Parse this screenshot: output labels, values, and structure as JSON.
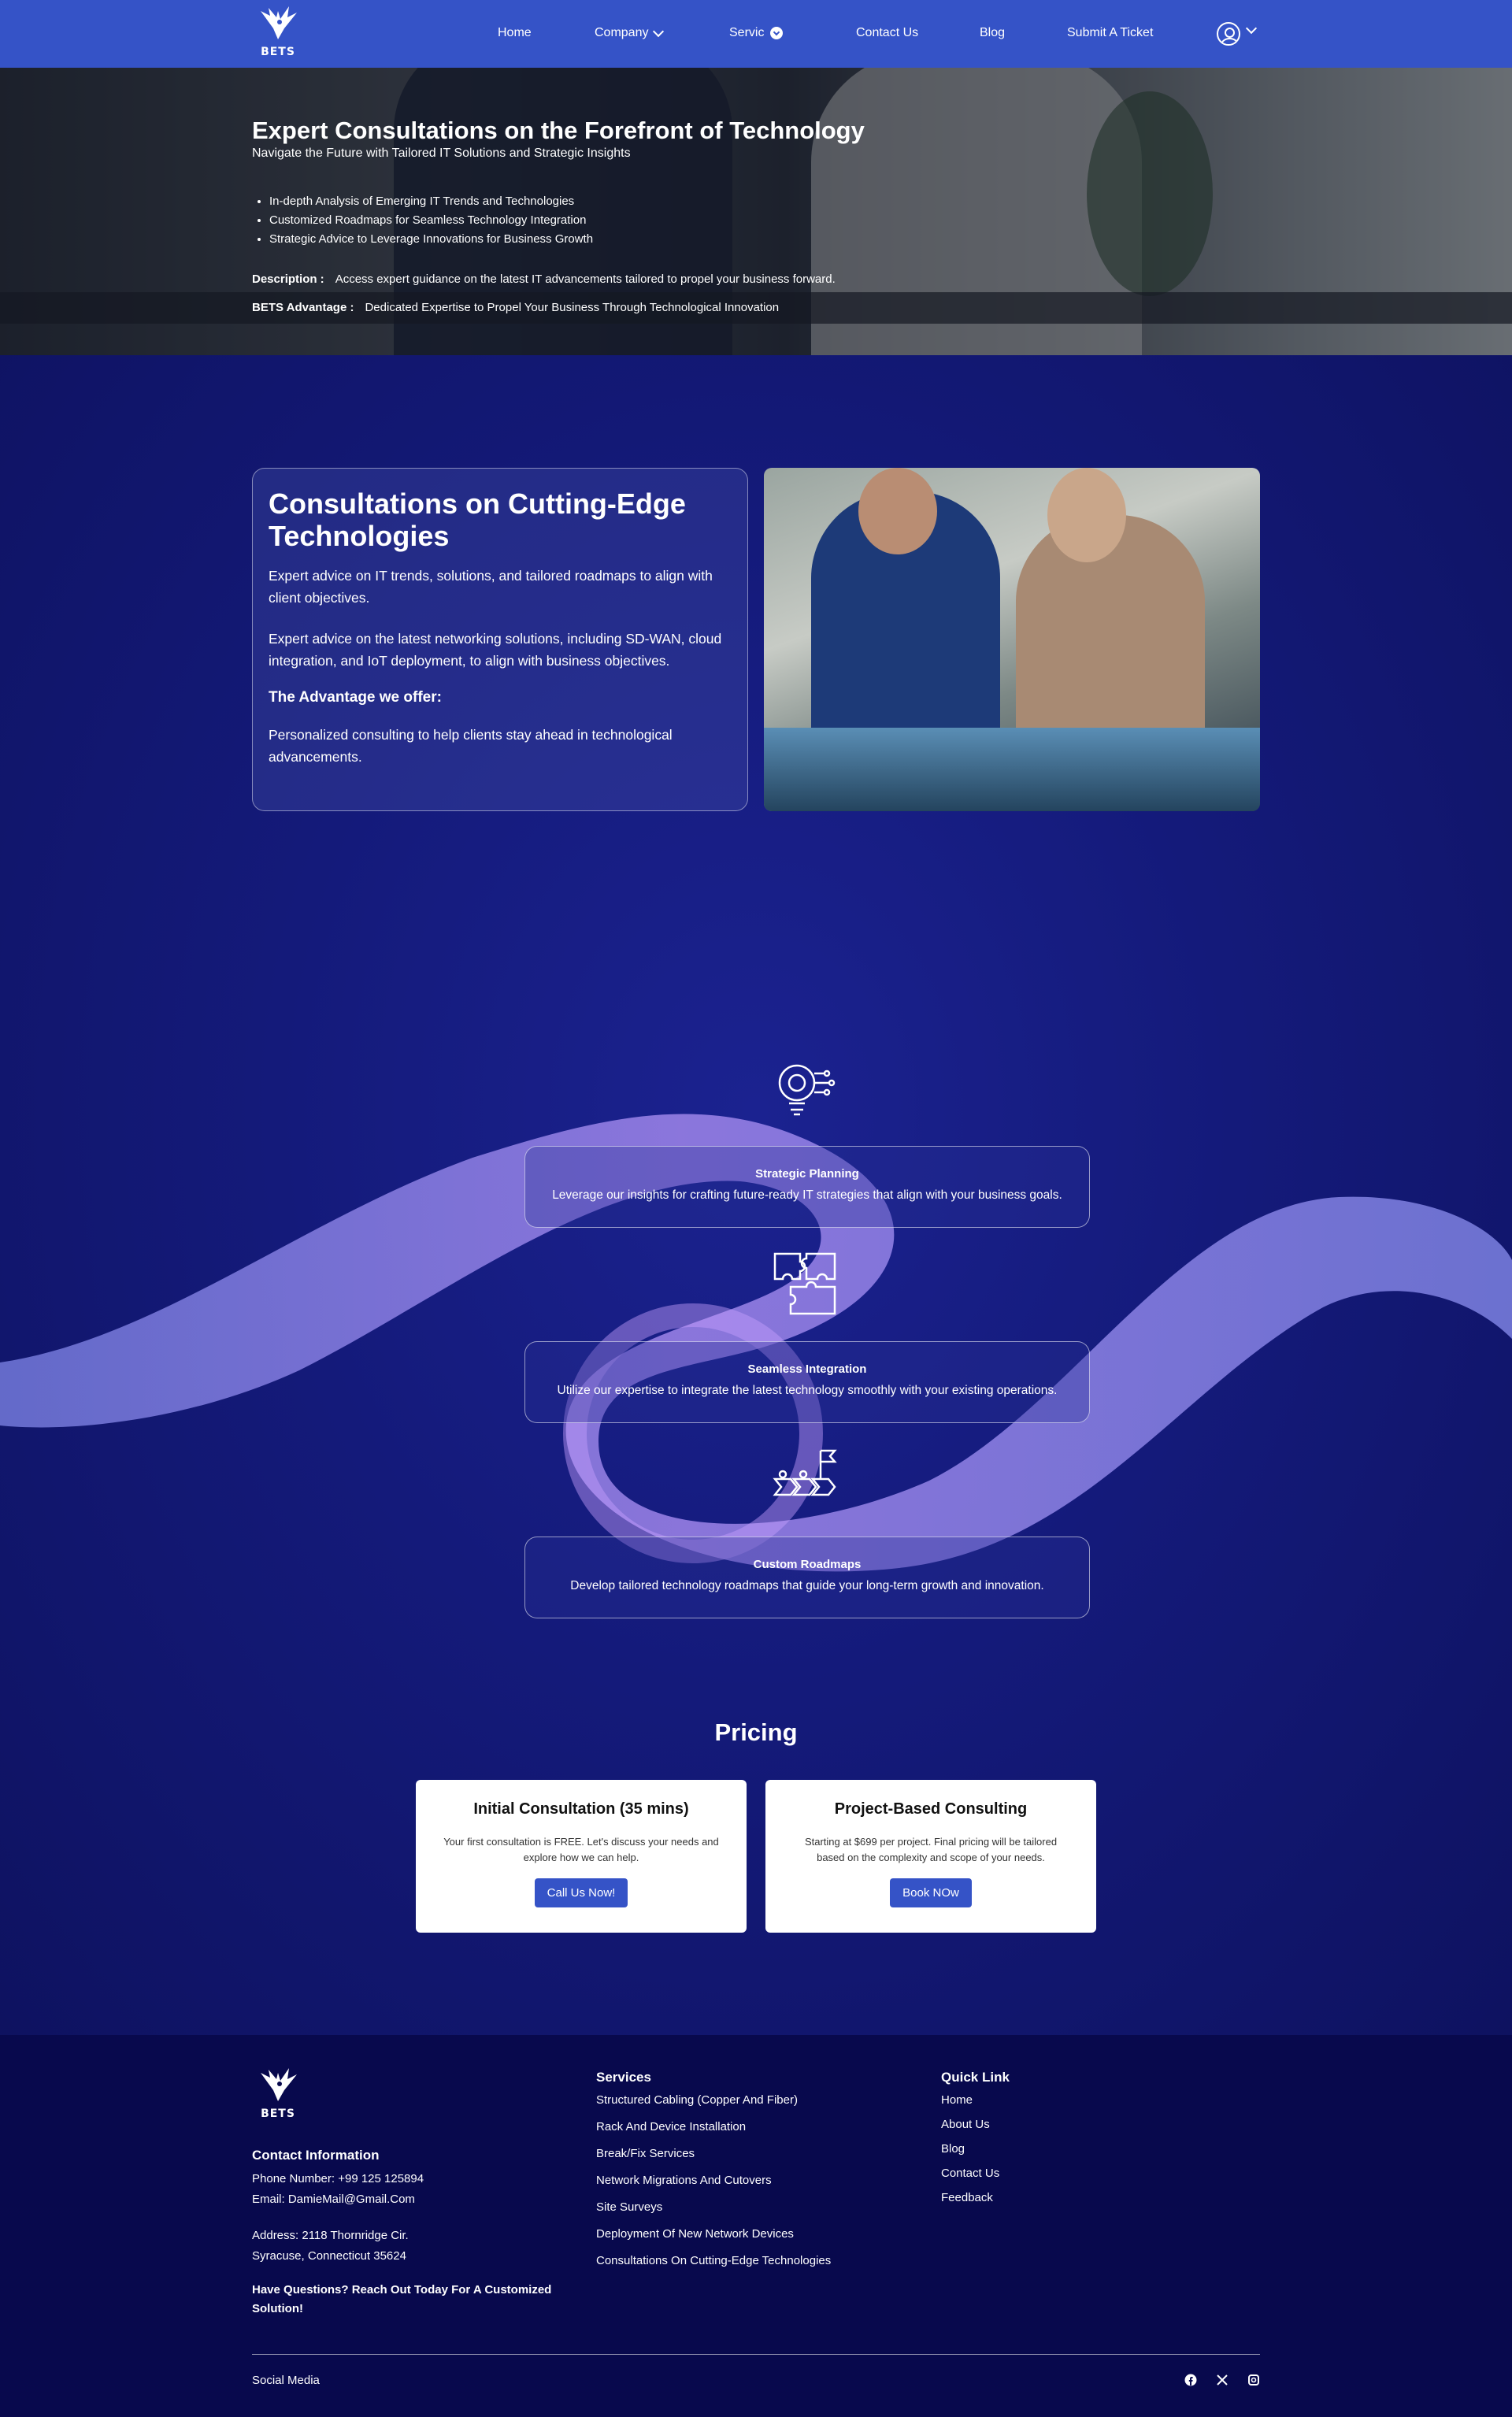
{
  "nav": {
    "brand": "BETS",
    "items": [
      {
        "label": "Home"
      },
      {
        "label": "Company"
      },
      {
        "label": "Servic"
      },
      {
        "label": "Contact Us"
      },
      {
        "label": "Blog"
      },
      {
        "label": "Submit A Ticket"
      }
    ]
  },
  "hero": {
    "title": "Expert Consultations on the Forefront of Technology",
    "subtitle": "Navigate the Future with Tailored IT Solutions and Strategic Insights",
    "bullets": [
      "In-depth Analysis of Emerging IT Trends and Technologies",
      "Customized Roadmaps for Seamless Technology Integration",
      "Strategic Advice to Leverage Innovations for Business Growth"
    ],
    "description_label": "Description :",
    "description": "Access expert guidance on the latest IT advancements tailored to propel your business forward.",
    "advantage_label": "BETS Advantage :",
    "advantage": "Dedicated Expertise to Propel Your Business Through Technological Innovation"
  },
  "consult": {
    "title": "Consultations on Cutting-Edge Technologies",
    "p1": "Expert advice on IT trends, solutions, and tailored roadmaps to align with client objectives.",
    "p2": "Expert advice on the latest networking solutions, including SD-WAN, cloud integration, and IoT deployment, to align with business objectives.",
    "advantage_title": "The Advantage we offer:",
    "advantage_text": "Personalized consulting to help clients stay ahead in technological advancements."
  },
  "features": [
    {
      "title": "Strategic Planning",
      "desc": "Leverage our insights for crafting future-ready IT strategies that align with your business goals.",
      "icon": "gear-bulb-icon"
    },
    {
      "title": "Seamless Integration",
      "desc": "Utilize our expertise to integrate the latest technology smoothly with your existing operations.",
      "icon": "puzzle-icon"
    },
    {
      "title": "Custom Roadmaps",
      "desc": "Develop tailored technology roadmaps that guide your long-term growth and innovation.",
      "icon": "roadmap-flag-icon"
    }
  ],
  "pricing": {
    "title": "Pricing",
    "cards": [
      {
        "title": "Initial Consultation (35 mins)",
        "desc": "Your first consultation is FREE. Let's discuss your needs and explore how we can help.",
        "button": "Call Us Now!"
      },
      {
        "title": "Project-Based Consulting",
        "desc": "Starting at $699 per project. Final pricing will be tailored based on the complexity and scope of your needs.",
        "button": "Book NOw"
      }
    ]
  },
  "footer": {
    "brand": "BETS",
    "contact_title": "Contact Information",
    "phone": "Phone Number: +99 125 125894",
    "email": "Email: DamieMail@Gmail.Com",
    "address1": "Address: 2118 Thornridge Cir.",
    "address2": "Syracuse, Connecticut 35624",
    "question": "Have Questions? Reach Out Today For A Customized Solution!",
    "services_title": "Services",
    "services": [
      "Structured Cabling (Copper And Fiber)",
      "Rack And Device Installation",
      "Break/Fix Services",
      "Network Migrations And Cutovers",
      "Site Surveys",
      "Deployment Of New Network Devices",
      "Consultations On Cutting-Edge Technologies"
    ],
    "quick_title": "Quick Link",
    "quick": [
      "Home",
      "About Us",
      "Blog",
      "Contact Us",
      "Feedback"
    ],
    "social_label": "Social Media"
  },
  "colors": {
    "nav": "#3553c7",
    "main_bg": "#11166a",
    "footer_bg": "#08094d",
    "button": "#3553c7"
  }
}
